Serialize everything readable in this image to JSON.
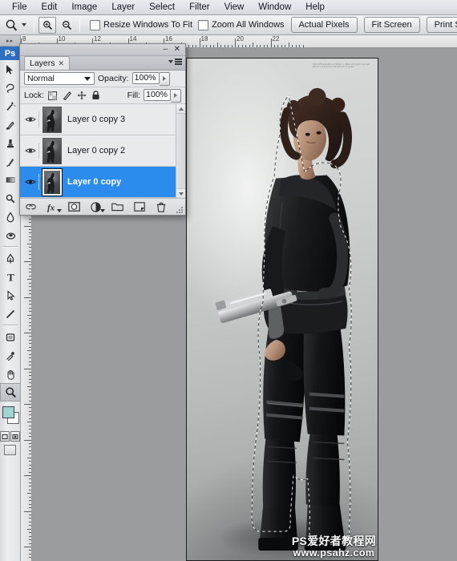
{
  "app": {
    "title": "Adobe Photoshop"
  },
  "menubar": {
    "items": [
      {
        "label": "File",
        "name": "menu-file"
      },
      {
        "label": "Edit",
        "name": "menu-edit"
      },
      {
        "label": "Image",
        "name": "menu-image"
      },
      {
        "label": "Layer",
        "name": "menu-layer"
      },
      {
        "label": "Select",
        "name": "menu-select"
      },
      {
        "label": "Filter",
        "name": "menu-filter"
      },
      {
        "label": "View",
        "name": "menu-view"
      },
      {
        "label": "Window",
        "name": "menu-window"
      },
      {
        "label": "Help",
        "name": "menu-help"
      }
    ]
  },
  "options_bar": {
    "active_tool_icon": "zoom-tool-icon",
    "zoom_in_icon": "zoom-in-icon",
    "zoom_out_icon": "zoom-out-icon",
    "checkboxes": [
      {
        "label": "Resize Windows To Fit",
        "checked": false,
        "name": "resize-windows-to-fit-checkbox"
      },
      {
        "label": "Zoom All Windows",
        "checked": false,
        "name": "zoom-all-windows-checkbox"
      }
    ],
    "buttons": [
      {
        "label": "Actual Pixels",
        "name": "actual-pixels-button"
      },
      {
        "label": "Fit Screen",
        "name": "fit-screen-button"
      },
      {
        "label": "Print Size",
        "name": "print-size-button"
      }
    ]
  },
  "toolbox": {
    "logo": "Ps",
    "tools": [
      {
        "name": "move-tool",
        "icon": "arrow-cursor-icon",
        "selected": false
      },
      {
        "name": "lasso-tool",
        "icon": "lasso-icon",
        "selected": false
      },
      {
        "name": "magic-wand-tool",
        "icon": "magic-wand-icon",
        "selected": false
      },
      {
        "name": "healing-brush-tool",
        "icon": "healing-brush-icon",
        "selected": false
      },
      {
        "name": "clone-stamp-tool",
        "icon": "stamp-icon",
        "selected": false
      },
      {
        "name": "history-brush-tool",
        "icon": "history-brush-icon",
        "selected": false
      },
      {
        "name": "gradient-tool",
        "icon": "gradient-icon",
        "selected": false
      },
      {
        "name": "dodge-tool",
        "icon": "dodge-icon",
        "selected": false
      },
      {
        "name": "blur-tool",
        "icon": "blur-drop-icon",
        "selected": false
      },
      {
        "name": "burn-tool",
        "icon": "burn-hand-icon",
        "selected": false
      },
      {
        "name": "pen-tool",
        "icon": "pen-icon",
        "selected": false
      },
      {
        "name": "type-tool",
        "icon": "type-T-icon",
        "selected": false
      },
      {
        "name": "path-selection-tool",
        "icon": "path-arrow-icon",
        "selected": false
      },
      {
        "name": "line-tool",
        "icon": "line-icon",
        "selected": false
      },
      {
        "name": "shape-tool",
        "icon": "rectangle-shape-icon",
        "selected": false
      },
      {
        "name": "eyedropper-tool",
        "icon": "eyedropper-icon",
        "selected": false
      },
      {
        "name": "hand-tool",
        "icon": "hand-icon",
        "selected": false
      },
      {
        "name": "zoom-tool",
        "icon": "magnifier-icon",
        "selected": true
      }
    ],
    "foreground_color": "#9fd6d2",
    "background_color": "#ffffff",
    "quick_mask_icon": "quick-mask-icon",
    "screen_mode_icon": "screen-mode-icon"
  },
  "panel": {
    "tab_label": "Layers",
    "close_tab_icon": "close-icon",
    "minimize_icon": "minimize-icon",
    "close_icon": "close-icon",
    "menu_icon": "panel-menu-icon",
    "blend_mode": "Normal",
    "opacity_label": "Opacity:",
    "opacity_value": "100%",
    "lock_label": "Lock:",
    "fill_label": "Fill:",
    "fill_value": "100%",
    "lock_icons": [
      {
        "name": "lock-transparent-pixels-icon"
      },
      {
        "name": "lock-image-pixels-icon"
      },
      {
        "name": "lock-position-icon"
      },
      {
        "name": "lock-all-icon"
      }
    ],
    "layers": [
      {
        "name": "Layer 0 copy 3",
        "visible": true,
        "selected": false
      },
      {
        "name": "Layer 0 copy 2",
        "visible": true,
        "selected": false
      },
      {
        "name": "Layer 0 copy",
        "visible": true,
        "selected": true
      }
    ],
    "footer_icons": [
      {
        "name": "link-layers-icon"
      },
      {
        "name": "layer-styles-fx-icon"
      },
      {
        "name": "add-layer-mask-icon"
      },
      {
        "name": "new-adjustment-layer-icon"
      },
      {
        "name": "new-group-icon"
      },
      {
        "name": "new-layer-icon"
      },
      {
        "name": "delete-layer-icon"
      }
    ],
    "selection_color": "#2b8ced"
  },
  "document": {
    "ruler_unit_labels_h": [
      "8",
      "10",
      "12",
      "14",
      "16",
      "18",
      "20",
      "22"
    ],
    "photo_fine_print": "Stock Photography by\nModel: L. Baker\nAll rights reserved\n\nNot for commercial reproduction or resale",
    "watermark": {
      "line1": "PS爱好者教程网",
      "line2": "www.psahz.com"
    }
  }
}
